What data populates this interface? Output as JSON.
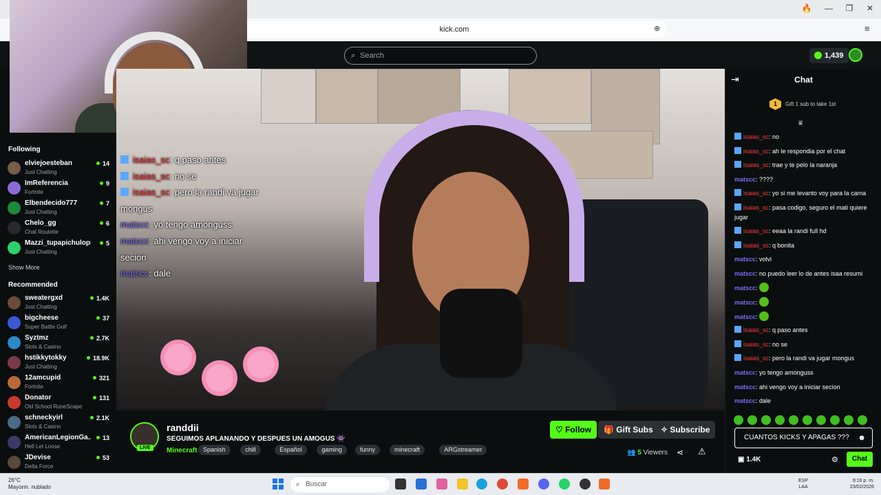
{
  "browser": {
    "url": "kick.com"
  },
  "header": {
    "search_placeholder": "Search",
    "kicks_balance": "1,439"
  },
  "sidebar": {
    "following_title": "Following",
    "following": [
      {
        "name": "elviejoesteban",
        "category": "Just Chatting",
        "viewers": "14",
        "color": "#7a5c4a"
      },
      {
        "name": "ImReferencia",
        "category": "Fortnite",
        "viewers": "9",
        "color": "#8a6bd8"
      },
      {
        "name": "Elbendecido777",
        "category": "Just Chatting",
        "viewers": "7",
        "color": "#1c8a3a"
      },
      {
        "name": "Chelo_gg",
        "category": "Chat Roulette",
        "viewers": "6",
        "color": "#2a2a2a"
      },
      {
        "name": "Mazzi_tupapichulopr",
        "category": "Just Chatting",
        "viewers": "5",
        "color": "#2bd16a"
      }
    ],
    "show_more": "Show More",
    "recommended_title": "Recommended",
    "recommended": [
      {
        "name": "sweatergxd",
        "category": "Just Chatting",
        "viewers": "1.4K",
        "color": "#6b4a3a"
      },
      {
        "name": "bigcheese",
        "category": "Super Battle Golf",
        "viewers": "37",
        "color": "#3a5ad8"
      },
      {
        "name": "Syztmz",
        "category": "Slots & Casino",
        "viewers": "2.7K",
        "color": "#2a8ac8"
      },
      {
        "name": "hstikkytokky",
        "category": "Just Chatting",
        "viewers": "18.9K",
        "color": "#7a3a4a"
      },
      {
        "name": "12amcupid",
        "category": "Fortnite",
        "viewers": "321",
        "color": "#b86a3a"
      },
      {
        "name": "Donator",
        "category": "Old School RuneScape",
        "viewers": "131",
        "color": "#c83a2a"
      },
      {
        "name": "schneckyirl",
        "category": "Slots & Casino",
        "viewers": "2.1K",
        "color": "#4a6a8a"
      },
      {
        "name": "AmericanLegionGa...",
        "category": "Hell Let Loose",
        "viewers": "13",
        "color": "#3a3a6a"
      },
      {
        "name": "JDevise",
        "category": "Delta Force",
        "viewers": "53",
        "color": "#5a4a3a"
      }
    ]
  },
  "overlay_chat": [
    {
      "user": "isaias_sc",
      "red": true,
      "text": ": q paso antes"
    },
    {
      "user": "isaias_sc",
      "red": true,
      "text": ": no se"
    },
    {
      "user": "isaias_sc",
      "red": true,
      "text": ": pero la randi va jugar"
    },
    {
      "user": "",
      "red": false,
      "text": "mongus"
    },
    {
      "user": "matscc",
      "red": false,
      "text": ": yo tengo amonguss"
    },
    {
      "user": "matscc",
      "red": false,
      "text": ": ahi vengo voy a iniciar"
    },
    {
      "user": "",
      "red": false,
      "text": "secion"
    },
    {
      "user": "matscc",
      "red": false,
      "text": ": dale"
    }
  ],
  "stream": {
    "streamer": "randdii",
    "live_label": "LIVE",
    "title": "SEGUIMOS APLANANDO Y DESPUES UN AMOGUS 👾",
    "category": "Minecraft",
    "tags": [
      "Spanish",
      "chill",
      "Español",
      "gaming",
      "funny",
      "minecraft",
      "ARGstreamer"
    ],
    "follow_label": "Follow",
    "gift_subs_label": "Gift Subs",
    "subscribe_label": "Subscribe",
    "viewers_count": "5",
    "viewers_label": "Viewers"
  },
  "chat": {
    "title": "Chat",
    "gift_rank": "1",
    "gift_text": "Gift 1 sub to take 1st",
    "messages": [
      {
        "user": "isaias_sc",
        "red": true,
        "text": ": no"
      },
      {
        "user": "isaias_sc",
        "red": true,
        "text": ": ah le respondia por el chat"
      },
      {
        "user": "isaias_sc",
        "red": true,
        "text": ": trae y te pelo la naranja"
      },
      {
        "user": "matscc",
        "red": false,
        "text": ": ????"
      },
      {
        "user": "isaias_sc",
        "red": true,
        "text": ": yo si me levanto voy para la cama"
      },
      {
        "user": "isaias_sc",
        "red": true,
        "text": ": pasa codigo, seguro el mati quiere jugar"
      },
      {
        "user": "isaias_sc",
        "red": true,
        "text": ": eeaa la randi full hd"
      },
      {
        "user": "isaias_sc",
        "red": true,
        "text": ": q bonita"
      },
      {
        "user": "matscc",
        "red": false,
        "text": ": volvi"
      },
      {
        "user": "matscc",
        "red": false,
        "text": ": no puedo leer lo de antes isaa resumi"
      },
      {
        "user": "matscc",
        "red": false,
        "text": ": ",
        "emote": true
      },
      {
        "user": "matscc",
        "red": false,
        "text": ": ",
        "emote": true
      },
      {
        "user": "matscc",
        "red": false,
        "text": ": ",
        "emote": true
      },
      {
        "user": "isaias_sc",
        "red": true,
        "text": ": q paso antes"
      },
      {
        "user": "isaias_sc",
        "red": true,
        "text": ": no se"
      },
      {
        "user": "isaias_sc",
        "red": true,
        "text": ": pero la randi va jugar mongus"
      },
      {
        "user": "matscc",
        "red": false,
        "text": ": yo tengo amonguss"
      },
      {
        "user": "matscc",
        "red": false,
        "text": ": ahi vengo voy a iniciar secion"
      },
      {
        "user": "matscc",
        "red": false,
        "text": ": dale"
      }
    ],
    "input_value": "CUANTOS KICKS Y APAGAS ???",
    "kicks_count": "1.4K",
    "send_label": "Chat"
  },
  "taskbar": {
    "temperature": "26°C",
    "weather": "Mayorm. nublado",
    "search_placeholder": "Buscar",
    "lang_top": "ESP",
    "lang_bottom": "LAA",
    "time": "9:16 p. m.",
    "date": "23/02/2026"
  }
}
